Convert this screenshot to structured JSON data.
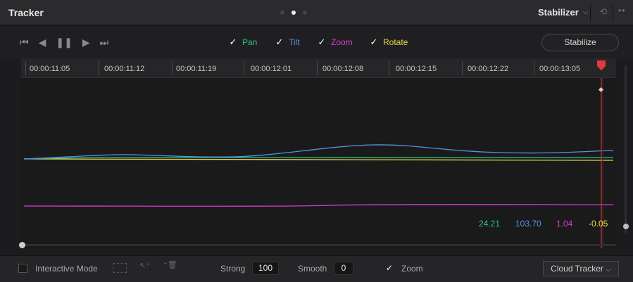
{
  "window": {
    "title": "Tracker",
    "mode": "Stabilizer"
  },
  "transport": [
    "jump-to-start",
    "step-back",
    "pause",
    "play",
    "jump-to-end"
  ],
  "checkboxes": {
    "pan": {
      "label": "Pan",
      "checked": true,
      "color": "#27c58a"
    },
    "tilt": {
      "label": "Tilt",
      "checked": true,
      "color": "#5b8fe6"
    },
    "zoom": {
      "label": "Zoom",
      "checked": true,
      "color": "#d43cd4"
    },
    "rotate": {
      "label": "Rotate",
      "checked": true,
      "color": "#e6d84a"
    }
  },
  "stabilize_label": "Stabilize",
  "ruler": [
    "00:00:11:05",
    "00:00:11:12",
    "00:00:11:19",
    "00:00:12:01",
    "00:00:12:08",
    "00:00:12:15",
    "00:00:12:22",
    "00:00:13:05"
  ],
  "readouts": {
    "pan": "24.21",
    "tilt": "103.70",
    "zoom": "1.04",
    "rotate": "-0.05"
  },
  "bottom": {
    "interactive_mode": "Interactive Mode",
    "strong_label": "Strong",
    "strong_value": "100",
    "smooth_label": "Smooth",
    "smooth_value": "0",
    "zoom_label": "Zoom",
    "zoom_checked": true,
    "cloud_tracker": "Cloud Tracker"
  },
  "colors": {
    "playhead": "#e53a3a",
    "pan": "#27c58a",
    "tilt": "#5b8fe6",
    "zoom": "#d43cd4",
    "rotate": "#e6d84a"
  }
}
